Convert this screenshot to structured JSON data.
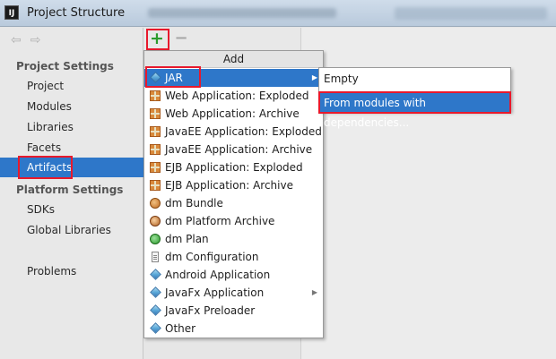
{
  "window": {
    "app_icon_text": "IJ",
    "title": "Project Structure"
  },
  "nav": {
    "back_glyph": "⇦",
    "forward_glyph": "⇨",
    "project_settings_header": "Project Settings",
    "project_settings": [
      "Project",
      "Modules",
      "Libraries",
      "Facets",
      "Artifacts"
    ],
    "platform_settings_header": "Platform Settings",
    "platform_settings": [
      "SDKs",
      "Global Libraries"
    ],
    "problems": "Problems",
    "selected": "Artifacts"
  },
  "toolbar": {
    "add_glyph": "+",
    "remove_glyph": "−"
  },
  "popup": {
    "header": "Add",
    "items": [
      {
        "label": "JAR",
        "icon": "jar-icon",
        "has_submenu": true,
        "highlighted": true
      },
      {
        "label": "Web Application: Exploded",
        "icon": "web-app-exploded-icon"
      },
      {
        "label": "Web Application: Archive",
        "icon": "web-app-archive-icon"
      },
      {
        "label": "JavaEE Application: Exploded",
        "icon": "javaee-exploded-icon"
      },
      {
        "label": "JavaEE Application: Archive",
        "icon": "javaee-archive-icon"
      },
      {
        "label": "EJB Application: Exploded",
        "icon": "ejb-exploded-icon"
      },
      {
        "label": "EJB Application: Archive",
        "icon": "ejb-archive-icon"
      },
      {
        "label": "dm Bundle",
        "icon": "dm-bundle-icon"
      },
      {
        "label": "dm Platform Archive",
        "icon": "dm-platform-archive-icon"
      },
      {
        "label": "dm Plan",
        "icon": "dm-plan-icon"
      },
      {
        "label": "dm Configuration",
        "icon": "dm-configuration-icon"
      },
      {
        "label": "Android Application",
        "icon": "android-app-icon"
      },
      {
        "label": "JavaFx Application",
        "icon": "javafx-app-icon",
        "has_submenu": true
      },
      {
        "label": "JavaFx Preloader",
        "icon": "javafx-preloader-icon"
      },
      {
        "label": "Other",
        "icon": "other-icon"
      }
    ]
  },
  "submenu": {
    "items": [
      "Empty",
      "From modules with dependencies..."
    ],
    "highlighted_index": 1
  },
  "colors": {
    "selection": "#2e77c9",
    "annotation_red": "#e8192c",
    "add_green": "#2d9b2d"
  }
}
